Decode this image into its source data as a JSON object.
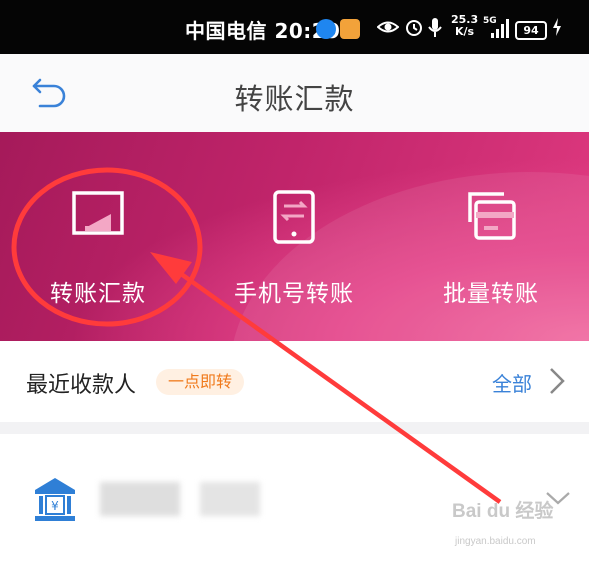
{
  "status_bar": {
    "carrier_time": "中国电信 20:29",
    "speed_value": "25.3",
    "speed_unit": "K/s",
    "network": "5G",
    "battery": "94"
  },
  "header": {
    "title": "转账汇款"
  },
  "banner": {
    "items": [
      {
        "label": "转账汇款",
        "icon": "transfer-icon"
      },
      {
        "label": "手机号转账",
        "icon": "phone-transfer-icon"
      },
      {
        "label": "批量转账",
        "icon": "batch-transfer-icon"
      }
    ]
  },
  "recent": {
    "title": "最近收款人",
    "tag": "一点即转",
    "all_label": "全部"
  },
  "watermark": {
    "text": "Bai du 经验",
    "url": "jingyan.baidu.com"
  },
  "colors": {
    "banner": "#c0246a",
    "accent": "#3a82d8",
    "annotation": "#ff3b3b"
  }
}
